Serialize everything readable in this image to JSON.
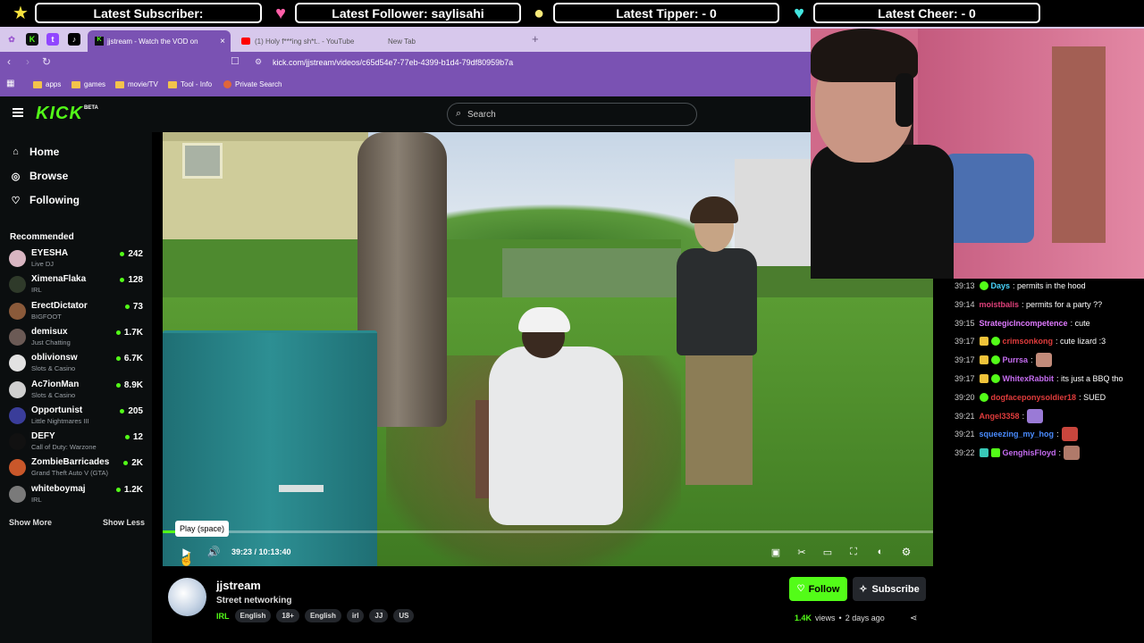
{
  "overlay": {
    "subscriber": "Latest Subscriber:",
    "follower": "Latest Follower: saylisahi",
    "tipper": "Latest Tipper:  - 0",
    "cheer": "Latest Cheer:  - 0"
  },
  "browser": {
    "tabs": [
      {
        "label": "jjstream - Watch the VOD on"
      },
      {
        "label": "(1) Holy f***ing sh*t.. - YouTube"
      },
      {
        "label": "New Tab"
      }
    ],
    "url": "kick.com/jjstream/videos/c65d54e7-77eb-4399-b1d4-79df80959b7a",
    "bookmarks": [
      "apps",
      "games",
      "movie/TV",
      "Tool - Info",
      "Private Search"
    ]
  },
  "kick": {
    "logo": "KICK",
    "beta": "BETA",
    "search_placeholder": "Search",
    "nav": {
      "home": "Home",
      "browse": "Browse",
      "following": "Following"
    },
    "recommended_title": "Recommended",
    "channels": [
      {
        "name": "EYESHA",
        "category": "Live DJ",
        "viewers": "242",
        "color": "#d9b6c2"
      },
      {
        "name": "XimenaFlaka",
        "category": "IRL",
        "viewers": "128",
        "color": "#2f3a2a"
      },
      {
        "name": "ErectDictator",
        "category": "BIGFOOT",
        "viewers": "73",
        "color": "#8a5a3a"
      },
      {
        "name": "demisux",
        "category": "Just Chatting",
        "viewers": "1.7K",
        "color": "#6b5a55"
      },
      {
        "name": "oblivionsw",
        "category": "Slots & Casino",
        "viewers": "6.7K",
        "color": "#e2e2e2"
      },
      {
        "name": "Ac7ionMan",
        "category": "Slots & Casino",
        "viewers": "8.9K",
        "color": "#cfcfcf"
      },
      {
        "name": "Opportunist",
        "category": "Little Nightmares III",
        "viewers": "205",
        "color": "#3a3d9a"
      },
      {
        "name": "DEFY",
        "category": "Call of Duty: Warzone",
        "viewers": "12",
        "color": "#111111"
      },
      {
        "name": "ZombieBarricades",
        "category": "Grand Theft Auto V (GTA)",
        "viewers": "2K",
        "color": "#c9572a"
      },
      {
        "name": "whiteboymaj",
        "category": "IRL",
        "viewers": "1.2K",
        "color": "#7a7a7a"
      }
    ],
    "show_more": "Show More",
    "show_less": "Show Less"
  },
  "player": {
    "tooltip": "Play (space)",
    "time": "39:23 / 10:13:40",
    "progress": 0.064
  },
  "chat": [
    {
      "time": "39:13",
      "user": "Days",
      "user_color": "#4ad6ff",
      "text": ": permits in the hood"
    },
    {
      "time": "39:14",
      "user": "moistbalis",
      "user_color": "#e0407a",
      "text": ": permits for a party ??"
    },
    {
      "time": "39:15",
      "user": "StrategicIncompetence",
      "user_color": "#e07aff",
      "text": ": cute"
    },
    {
      "time": "39:17",
      "user": "crimsonkong",
      "user_color": "#e03c3c",
      "text": ": cute lizard :3"
    },
    {
      "time": "39:17",
      "user": "Purrsa",
      "user_color": "#c56cf0",
      "text": ":"
    },
    {
      "time": "39:17",
      "user": "WhitexRabbit",
      "user_color": "#c56cf0",
      "text": ": its just a BBQ tho"
    },
    {
      "time": "39:20",
      "user": "dogfaceponysoldier18",
      "user_color": "#e03c3c",
      "text": ": SUED"
    },
    {
      "time": "39:21",
      "user": "Angel3358",
      "user_color": "#e03c3c",
      "text": ":"
    },
    {
      "time": "39:21",
      "user": "squeezing_my_hog",
      "user_color": "#4a8cff",
      "text": ":"
    },
    {
      "time": "39:22",
      "user": "GenghisFloyd",
      "user_color": "#c56cf0",
      "text": ":"
    }
  ],
  "channel_info": {
    "name": "jjstream",
    "title": "Street networking",
    "category": "IRL",
    "tags": [
      "English",
      "18+",
      "English",
      "irl",
      "JJ",
      "US"
    ],
    "follow": "Follow",
    "subscribe": "Subscribe",
    "views": "1.4K",
    "views_label": "views",
    "age": "2 days ago"
  }
}
